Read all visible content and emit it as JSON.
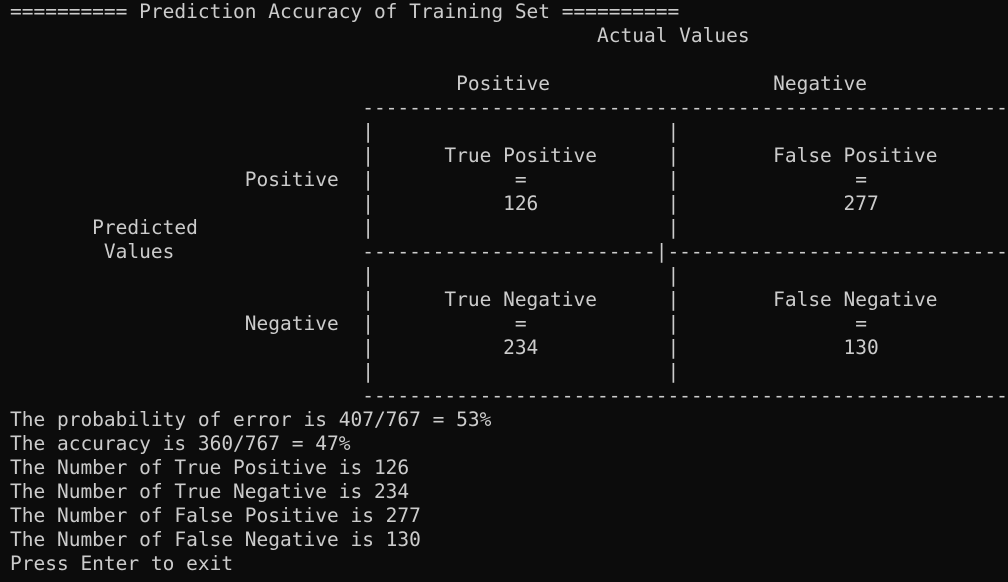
{
  "terminal": {
    "header": "========== Prediction Accuracy of Training Set ==========",
    "lines": [
      "                                                  Actual Values",
      "",
      "                                      Positive                   Negative",
      "                              -------------------------------------------------------",
      "                              |                         |",
      "                              |      True Positive      |        False Positive",
      "                    Positive  |            =            |               =",
      "                              |           126           |              277",
      "       Predicted              |                         |",
      "        Values                -------------------------|-----------------------------",
      "                              |                         |",
      "                              |      True Negative      |        False Negative",
      "                    Negative  |            =            |               =",
      "                              |           234           |              130",
      "                              |                         |",
      "                              -------------------------------------------------------",
      "The probability of error is 407/767 = 53%",
      "The accuracy is 360/767 = 47%",
      "The Number of True Positive is 126",
      "The Number of True Negative is 234",
      "The Number of False Positive is 277",
      "The Number of False Negative is 130",
      "Press Enter to exit"
    ]
  }
}
